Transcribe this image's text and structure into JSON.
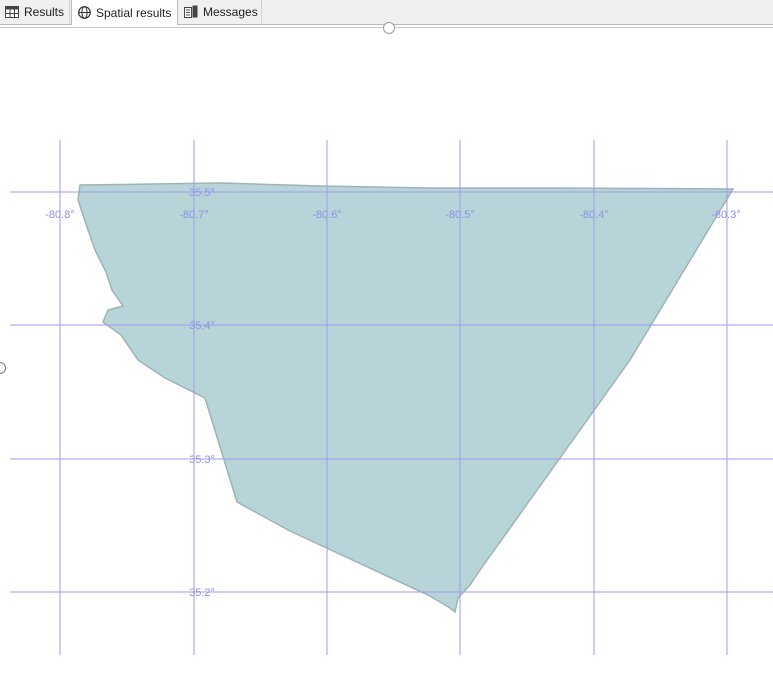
{
  "tabs": {
    "results_label": "Results",
    "spatial_label": "Spatial results",
    "messages_label": "Messages"
  },
  "map": {
    "grid_color": "#8f8fe8",
    "fill_color": "#b7d5d9",
    "stroke_color": "#9fb3b6",
    "lon_labels": [
      "-80.8°",
      "-80.7°",
      "-80.6°",
      "-80.5°",
      "-80.4°",
      "-80.3°"
    ],
    "lat_labels": [
      "35.5°",
      "35.4°",
      "35.3°",
      "35.2°"
    ]
  }
}
